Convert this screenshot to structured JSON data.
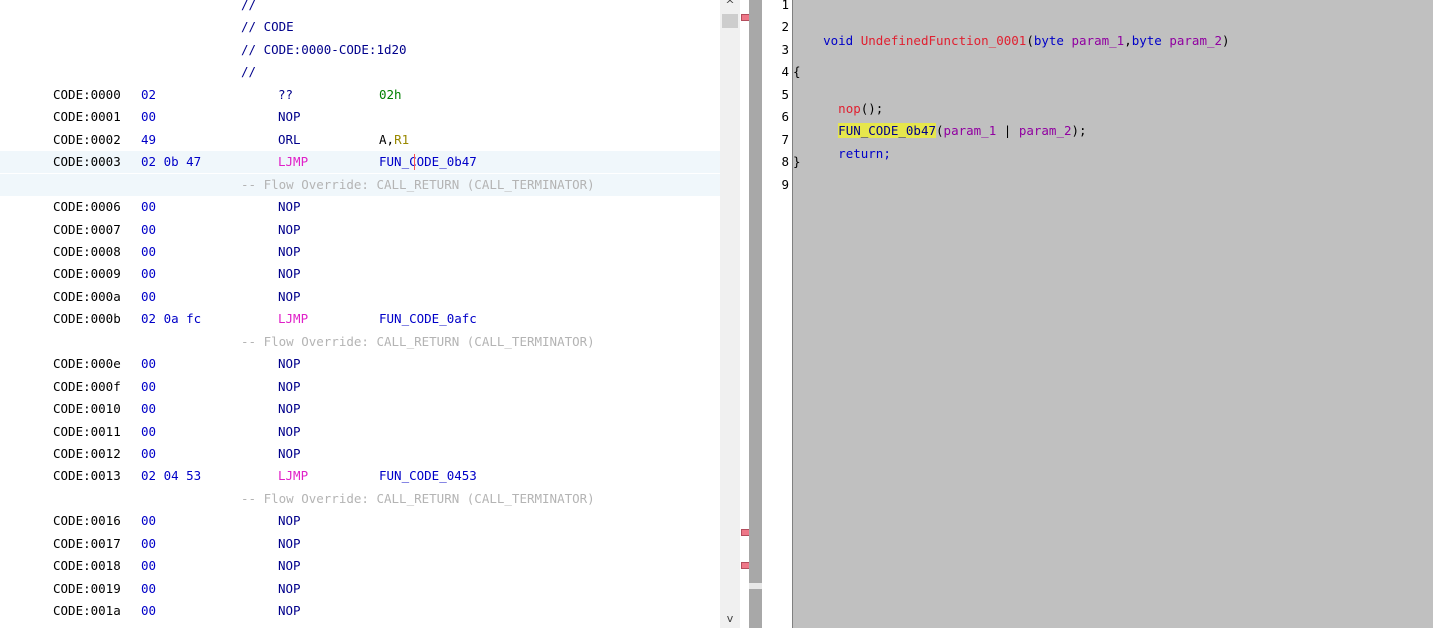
{
  "listing": {
    "rows": [
      {
        "type": "comment",
        "text": "//"
      },
      {
        "type": "comment",
        "text": "// CODE"
      },
      {
        "type": "comment",
        "text": "// CODE:0000-CODE:1d20"
      },
      {
        "type": "comment",
        "text": "//"
      },
      {
        "type": "instr",
        "addr": "CODE:0000",
        "bytes": "02",
        "mnem": "??",
        "oper": "02h",
        "operKind": "num"
      },
      {
        "type": "instr",
        "addr": "CODE:0001",
        "bytes": "00",
        "mnem": "NOP",
        "oper": ""
      },
      {
        "type": "instr",
        "addr": "CODE:0002",
        "bytes": "49",
        "mnem": "ORL",
        "oper": "A,",
        "reg": "R1"
      },
      {
        "type": "instr",
        "addr": "CODE:0003",
        "bytes": "02 0b 47",
        "mnem": "LJMP",
        "oper": "FUN_CODE_0b47",
        "operKind": "lbl",
        "selected": true
      },
      {
        "type": "flow",
        "text": "-- Flow Override: CALL_RETURN (CALL_TERMINATOR)",
        "selected": true
      },
      {
        "type": "instr",
        "addr": "CODE:0006",
        "bytes": "00",
        "mnem": "NOP",
        "oper": ""
      },
      {
        "type": "instr",
        "addr": "CODE:0007",
        "bytes": "00",
        "mnem": "NOP",
        "oper": ""
      },
      {
        "type": "instr",
        "addr": "CODE:0008",
        "bytes": "00",
        "mnem": "NOP",
        "oper": ""
      },
      {
        "type": "instr",
        "addr": "CODE:0009",
        "bytes": "00",
        "mnem": "NOP",
        "oper": ""
      },
      {
        "type": "instr",
        "addr": "CODE:000a",
        "bytes": "00",
        "mnem": "NOP",
        "oper": ""
      },
      {
        "type": "instr",
        "addr": "CODE:000b",
        "bytes": "02 0a fc",
        "mnem": "LJMP",
        "oper": "FUN_CODE_0afc",
        "operKind": "lbl"
      },
      {
        "type": "flow",
        "text": "-- Flow Override: CALL_RETURN (CALL_TERMINATOR)"
      },
      {
        "type": "instr",
        "addr": "CODE:000e",
        "bytes": "00",
        "mnem": "NOP",
        "oper": ""
      },
      {
        "type": "instr",
        "addr": "CODE:000f",
        "bytes": "00",
        "mnem": "NOP",
        "oper": ""
      },
      {
        "type": "instr",
        "addr": "CODE:0010",
        "bytes": "00",
        "mnem": "NOP",
        "oper": ""
      },
      {
        "type": "instr",
        "addr": "CODE:0011",
        "bytes": "00",
        "mnem": "NOP",
        "oper": ""
      },
      {
        "type": "instr",
        "addr": "CODE:0012",
        "bytes": "00",
        "mnem": "NOP",
        "oper": ""
      },
      {
        "type": "instr",
        "addr": "CODE:0013",
        "bytes": "02 04 53",
        "mnem": "LJMP",
        "oper": "FUN_CODE_0453",
        "operKind": "lbl"
      },
      {
        "type": "flow",
        "text": "-- Flow Override: CALL_RETURN (CALL_TERMINATOR)"
      },
      {
        "type": "instr",
        "addr": "CODE:0016",
        "bytes": "00",
        "mnem": "NOP",
        "oper": ""
      },
      {
        "type": "instr",
        "addr": "CODE:0017",
        "bytes": "00",
        "mnem": "NOP",
        "oper": ""
      },
      {
        "type": "instr",
        "addr": "CODE:0018",
        "bytes": "00",
        "mnem": "NOP",
        "oper": ""
      },
      {
        "type": "instr",
        "addr": "CODE:0019",
        "bytes": "00",
        "mnem": "NOP",
        "oper": ""
      },
      {
        "type": "instr",
        "addr": "CODE:001a",
        "bytes": "00",
        "mnem": "NOP",
        "oper": ""
      }
    ]
  },
  "decompiler": {
    "line_numbers": [
      "1",
      "2",
      "3",
      "4",
      "5",
      "6",
      "7",
      "8",
      "9"
    ],
    "line2": {
      "kw1": "void",
      "fn": "UndefinedFunction_0001",
      "open": "(",
      "kw2": "byte",
      "p1": "param_1",
      "comma": ",",
      "kw3": "byte",
      "p2": "param_2",
      "close": ")"
    },
    "line4": "{",
    "line5": {
      "fn": "nop",
      "rest": "();"
    },
    "line6": {
      "fn": "FUN_CODE_0b47",
      "open": "(",
      "p1": "param_1",
      "op": " | ",
      "p2": "param_2",
      "close": ");"
    },
    "line7": "return;",
    "line8": "}"
  },
  "colors": {
    "selection_row": "#f0f7fb",
    "mnemonic": "#00008b",
    "jump_mnemonic": "#e020c8",
    "label": "#0000c8",
    "flow_comment": "#b4b4b4",
    "decomp_bg": "#c0c0c0",
    "token_highlight": "#e6e64c"
  },
  "icons": {
    "scroll_up": "scroll-up-arrow-icon",
    "scroll_down": "scroll-down-arrow-icon"
  },
  "scroll": {
    "up_glyph": "^",
    "down_glyph": "v"
  }
}
